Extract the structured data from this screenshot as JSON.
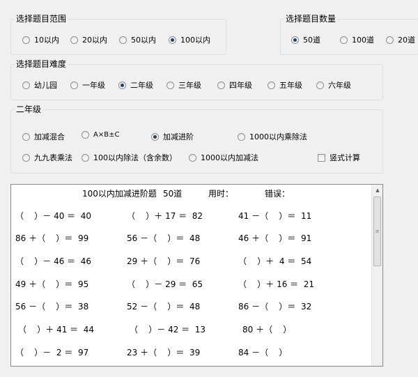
{
  "range_group": {
    "title": "选择题目范围",
    "options": [
      {
        "label": "10以内",
        "selected": false
      },
      {
        "label": "20以内",
        "selected": false
      },
      {
        "label": "50以内",
        "selected": false
      },
      {
        "label": "100以内",
        "selected": true
      }
    ]
  },
  "count_group": {
    "title": "选择题目数量",
    "options": [
      {
        "label": "50道",
        "selected": true
      },
      {
        "label": "100道",
        "selected": false
      },
      {
        "label": "20道",
        "selected": false
      }
    ]
  },
  "difficulty_group": {
    "title": "选择题目难度",
    "options": [
      {
        "label": "幼儿园",
        "selected": false
      },
      {
        "label": "一年级",
        "selected": false
      },
      {
        "label": "二年级",
        "selected": true
      },
      {
        "label": "三年级",
        "selected": false
      },
      {
        "label": "四年级",
        "selected": false
      },
      {
        "label": "五年级",
        "selected": false
      },
      {
        "label": "六年级",
        "selected": false
      }
    ]
  },
  "type_group": {
    "title": "二年级",
    "options": [
      {
        "label": "加减混合",
        "selected": false
      },
      {
        "label": "A×B±C",
        "selected": false
      },
      {
        "label": "加减进阶",
        "selected": true
      },
      {
        "label": "1000以内乘除法",
        "selected": false
      },
      {
        "label": "九九表乘法",
        "selected": false
      },
      {
        "label": "100以内除法（含余数）",
        "selected": false
      },
      {
        "label": "1000以内加减法",
        "selected": false
      }
    ],
    "vertical_checkbox": {
      "label": "竖式计算",
      "checked": false
    }
  },
  "output": {
    "title": "100以内加减进阶题",
    "count": "50道",
    "time_label": "用时：",
    "error_label": "错误：",
    "rows": [
      [
        "（    ）－ 40 ＝  40",
        "（    ）＋ 17 ＝  82",
        "41 －（    ）＝  11"
      ],
      [
        "86 ＋（    ）＝  99",
        "56 －（    ）＝  48",
        "46 ＋（    ）＝  91"
      ],
      [
        "（    ）－ 46 ＝  46",
        "29 ＋（    ）＝  76",
        "（    ）＋  4 ＝  54"
      ],
      [
        "49 ＋（    ）＝  95",
        "（    ）－ 29 ＝  65",
        "（    ）＋ 16 ＝  21"
      ],
      [
        "56 －（    ）＝  38",
        "52 －（    ）＝  48",
        "86 －（    ）＝  32"
      ],
      [
        "（    ）＋ 41 ＝  44",
        "（    ）－ 42 ＝  13",
        "80 ＋（    ）"
      ],
      [
        "（    ）－  2 ＝  97",
        "23 ＋（    ）＝  39",
        "84 －（    ）"
      ]
    ]
  },
  "scrollbar": {
    "up_icon": "scroll-up-arrow-icon",
    "thumb_icon": "scroll-thumb-grip-icon"
  }
}
